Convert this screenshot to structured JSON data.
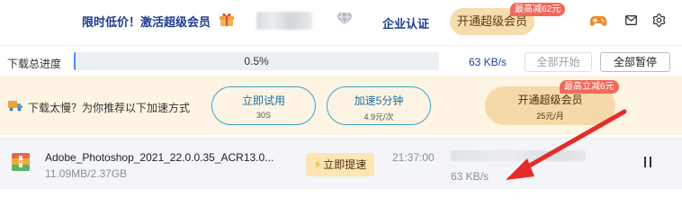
{
  "colors": {
    "brand_blue": "#1a3d8f",
    "progress_fill": "#4b8bf5",
    "vip_gold": "#f7dcae",
    "badge_red": "#f06a5a",
    "banner_bg": "#fdf4e3",
    "pill_border": "#3aa6c6",
    "annotation_red": "#e52b2b"
  },
  "header": {
    "promo_text": "限时低价！激活超级会员",
    "gift_icon": "gift-icon",
    "diamond_icon": "diamond-icon",
    "enterprise_label": "企业认证",
    "vip_button_label": "开通超级会员",
    "vip_badge": "最高减62元",
    "icons": [
      "game-controller-icon",
      "mail-icon",
      "settings-icon"
    ]
  },
  "overall": {
    "label": "下载总进度",
    "progress_fraction": 0.005,
    "progress_text": "0.5%",
    "speed": "63 KB/s",
    "start_all_label": "全部开始",
    "pause_all_label": "全部暂停"
  },
  "banner": {
    "icon": "truck-icon",
    "text": "下载太慢？为你推荐以下加速方式",
    "options": [
      {
        "label": "立即试用",
        "sub": "30S"
      },
      {
        "label": "加速5分钟",
        "sub": "4.9元/次"
      },
      {
        "label": "开通超级会员",
        "sub": "25元/月",
        "badge": "最高立减6元"
      }
    ]
  },
  "task": {
    "file_icon": "archive-file-icon",
    "name": "Adobe_Photoshop_2021_22.0.0.35_ACR13.0...",
    "size": "11.09MB/2.37GB",
    "boost_label": "立即提速",
    "remaining_time": "21:37:00",
    "speed": "63 KB/s",
    "pause_icon": "pause-icon"
  }
}
